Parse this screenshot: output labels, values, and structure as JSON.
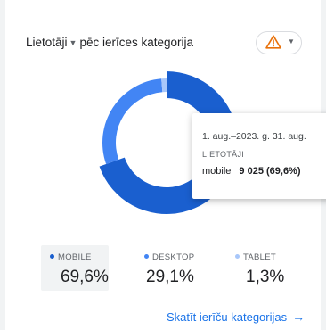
{
  "header": {
    "metric_label": "Lietotāji",
    "dimension_label": "pēc ierīces kategorija"
  },
  "warning_icon": "warning-triangle-icon",
  "colors": {
    "mobile": "#1a5fcf",
    "desktop": "#4285f4",
    "tablet": "#a8c7fa",
    "warning": "#e8710a",
    "link": "#1a73e8"
  },
  "chart_data": {
    "type": "pie",
    "categories": [
      "MOBILE",
      "DESKTOP",
      "TABLET"
    ],
    "values": [
      69.6,
      29.1,
      1.3
    ],
    "unit": "%"
  },
  "tooltip": {
    "date_range": "1. aug.–2023. g. 31. aug.",
    "metric": "LIETOTĀJI",
    "label": "mobile",
    "value": "9 025 (69,6%)"
  },
  "legend": [
    {
      "label": "MOBILE",
      "value": "69,6%"
    },
    {
      "label": "DESKTOP",
      "value": "29,1%"
    },
    {
      "label": "TABLET",
      "value": "1,3%"
    }
  ],
  "footer": {
    "link_label": "Skatīt ierīču kategorijas"
  }
}
